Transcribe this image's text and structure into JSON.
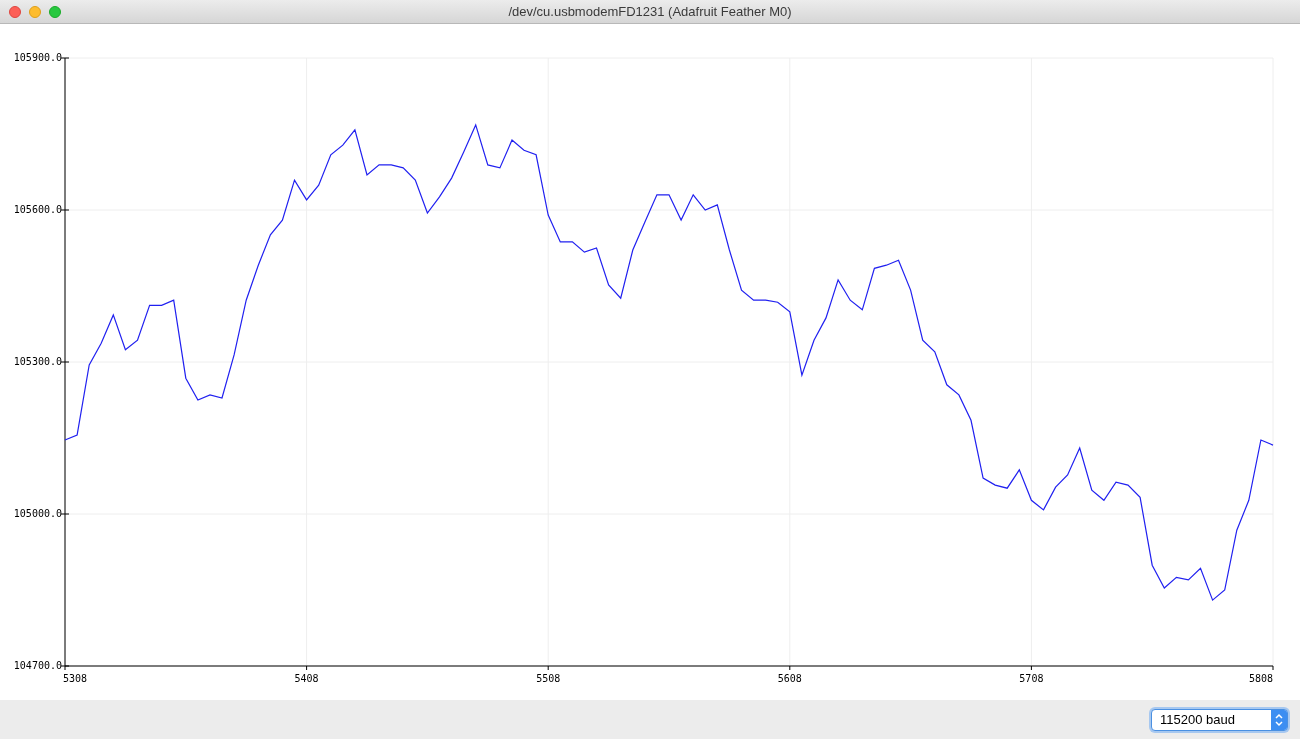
{
  "window": {
    "title": "/dev/cu.usbmodemFD1231 (Adafruit Feather M0)"
  },
  "plot": {
    "chart_data": {
      "type": "line",
      "x": [
        5308,
        5313,
        5318,
        5323,
        5328,
        5333,
        5338,
        5343,
        5348,
        5353,
        5358,
        5363,
        5368,
        5373,
        5378,
        5383,
        5388,
        5393,
        5398,
        5403,
        5408,
        5413,
        5418,
        5423,
        5428,
        5433,
        5438,
        5443,
        5448,
        5453,
        5458,
        5463,
        5468,
        5473,
        5478,
        5483,
        5488,
        5493,
        5498,
        5503,
        5508,
        5513,
        5518,
        5523,
        5528,
        5533,
        5538,
        5543,
        5548,
        5553,
        5558,
        5563,
        5568,
        5573,
        5578,
        5583,
        5588,
        5593,
        5598,
        5603,
        5608,
        5613,
        5618,
        5623,
        5628,
        5633,
        5638,
        5643,
        5648,
        5653,
        5658,
        5663,
        5668,
        5673,
        5678,
        5683,
        5688,
        5693,
        5698,
        5703,
        5708,
        5713,
        5718,
        5723,
        5728,
        5733,
        5738,
        5743,
        5748,
        5753,
        5758,
        5763,
        5768,
        5773,
        5778,
        5783,
        5788,
        5793,
        5798,
        5803,
        5808
      ],
      "grid": true,
      "series": [
        {
          "color": "#2020f0",
          "values": [
            105146,
            105156,
            105294,
            105337,
            105393,
            105324,
            105343,
            105412,
            105412,
            105422,
            105268,
            105225,
            105235,
            105229,
            105314,
            105422,
            105491,
            105551,
            105580,
            105659,
            105620,
            105649,
            105709,
            105728,
            105758,
            105669,
            105689,
            105689,
            105683,
            105659,
            105594,
            105626,
            105663,
            105714,
            105768,
            105689,
            105683,
            105738,
            105718,
            105709,
            105590,
            105537,
            105537,
            105517,
            105525,
            105452,
            105426,
            105521,
            105576,
            105630,
            105630,
            105580,
            105630,
            105600,
            105610,
            105521,
            105442,
            105422,
            105422,
            105418,
            105399,
            105274,
            105343,
            105387,
            105462,
            105422,
            105403,
            105485,
            105491,
            105501,
            105442,
            105343,
            105320,
            105255,
            105235,
            105185,
            105071,
            105057,
            105051,
            105087,
            105027,
            105008,
            105053,
            105077,
            105130,
            105047,
            105027,
            105063,
            105057,
            105033,
            104899,
            104854,
            104875,
            104870,
            104893,
            104830,
            104850,
            104968,
            105027,
            105146,
            105136
          ]
        }
      ],
      "xlim": [
        5308,
        5808
      ],
      "ylim": [
        104700,
        105900
      ],
      "xticks": [
        5308,
        5408,
        5508,
        5608,
        5708,
        5808
      ],
      "yticks": [
        {
          "value": 104700,
          "label": "104700.0"
        },
        {
          "value": 105000,
          "label": "105000.0"
        },
        {
          "value": 105300,
          "label": "105300.0"
        },
        {
          "value": 105600,
          "label": "105600.0"
        },
        {
          "value": 105900,
          "label": "105900.0"
        }
      ]
    }
  },
  "baud": {
    "value": "115200 baud"
  }
}
